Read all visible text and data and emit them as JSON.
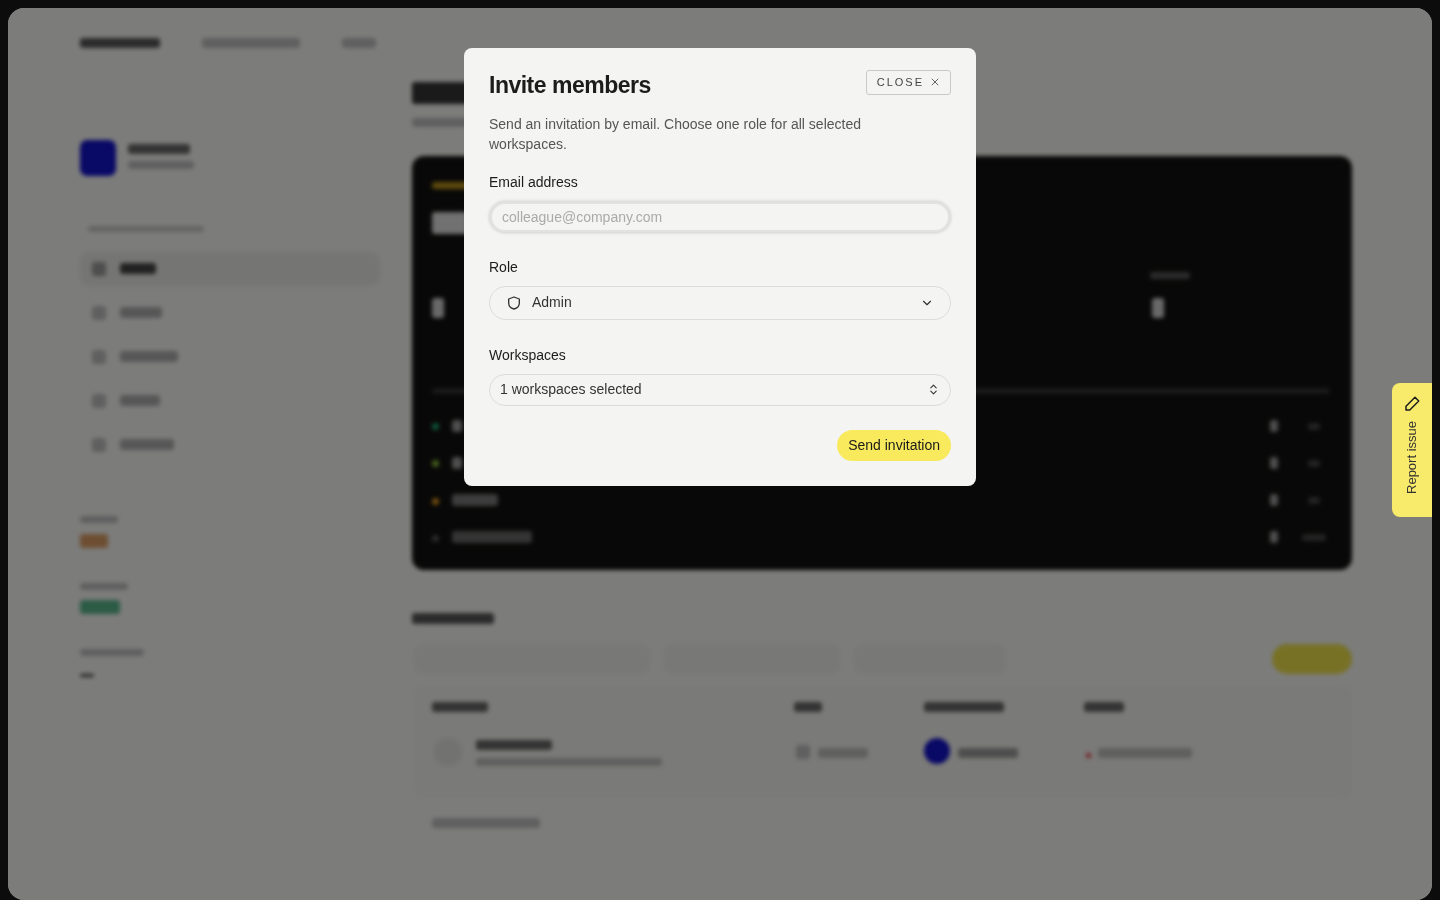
{
  "modal": {
    "title": "Invite members",
    "close_button": "CLOSE",
    "description": "Send an invitation by email. Choose one role for all selected workspaces.",
    "email": {
      "label": "Email address",
      "placeholder": "colleague@company.com"
    },
    "role": {
      "label": "Role",
      "value": "Admin"
    },
    "workspaces": {
      "label": "Workspaces",
      "value": "1 workspaces selected"
    },
    "submit_button": "Send invitation"
  },
  "report_tab": {
    "label": "Report issue"
  }
}
